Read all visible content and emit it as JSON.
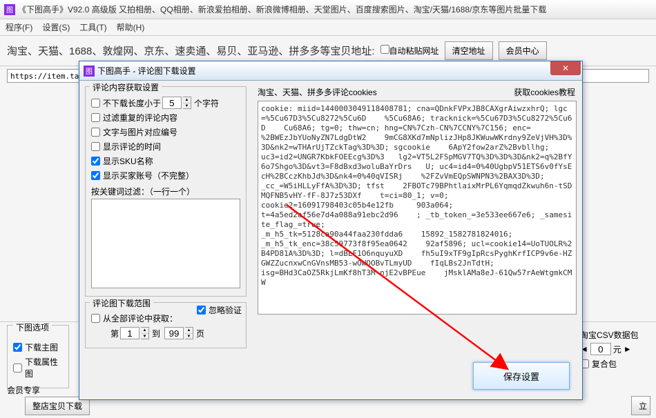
{
  "main": {
    "title": "《下图高手》V92.0 高级版 又拍相册、QQ相册、新浪爱拍相册、新浪微博相册、天堂图片、百度搜索图片、淘宝/天猫/1688/京东等图片批量下载",
    "menu": {
      "program": "程序(F)",
      "settings": "设置(S)",
      "tools": "工具(T)",
      "help": "帮助(H)"
    },
    "toolbar": {
      "label": "淘宝、天猫、1688、敦煌网、京东、速卖通、易贝、亚马逊、拼多多等宝贝地址:",
      "auto_paste": "自动粘贴网址",
      "clear_btn": "清空地址",
      "center_btn": "会员中心"
    },
    "url_value": "https://item.tao",
    "bottom": {
      "download_opts": "下图选项",
      "dl_main": "下载主图",
      "dl_attr": "下载属性图",
      "member": "会员专享",
      "whole": "整店宝贝下载",
      "csv_title": "淘宝CSV数据包",
      "price": "0",
      "unit": "元",
      "combo": "复合包",
      "go": "立"
    }
  },
  "dialog": {
    "title": "下图高手 - 评论图下载设置",
    "group1_title": "评论内容获取设置",
    "opt_minlen": "不下载长度小于",
    "opt_minlen_val": "5",
    "opt_minlen_suffix": "个字符",
    "opt_dedup": "过滤重复的评论内容",
    "opt_txtimg": "文字与图片对应编号",
    "opt_time": "显示评论的时间",
    "opt_sku": "显示SKU名称",
    "opt_buyer": "显示买家账号（不完整）",
    "kw_label": "按关键词过滤：（一行一个）",
    "group2_title": "评论图下载范围",
    "opt_ignore_v": "忽略验证",
    "opt_fromall": "从全部评论中获取：",
    "page_from_lbl": "第",
    "page_from": "1",
    "page_to_lbl": "到",
    "page_to": "99",
    "page_suffix": "页",
    "right_title": "淘宝、天猫、拼多多评论cookies",
    "tutorial": "获取cookies教程",
    "cookies": "cookie: miid=1440003049118408781; cna=QDnkFVPxJB8CAXgrAiwzxhrQ; lgc=%5Cu67D3%5Cu8272%5Cu6D    %5Cu68A6; tracknick=%5Cu67D3%5Cu8272%5Cu6D    Cu68A6; tg=0; thw=cn; hng=CN%7Czh-CN%7CCNY%7C156; enc=\n%2BWEzJbYUoNyZN7LdgDtW2    9mCG8XKd7mNplizJHp8JKWuwWKrdny9ZeVjVH%3D%3D&nk2=wTHArUjTZckTag%3D%3D; sgcookie    6ApY2fow2arZ%2Bvbllhg;\nuc3=id2=UNGR7KbkFOEEcg%3D%3   lg2=VT5L2FSpMGV7TQ%3D%3D%3D&nk2=q%2BfY6o7Shgo%3D&vt3=F8dBxd3woluBaYrDrs   U; uc4=id4=0%40UgbpV51ETS6v0fYsEcH%2BCczKhbJd%3D&nk4=0%40qVISRj    %2FZvVmEQpSWNPN3%2BAX3D%3D;\n_cc_=W5iHLLyFfA%3D%3D; tfst    2FBOTc79BPhtlaixMrPL6YqmqdZkwuh6n-tSDMQFNB5vHY-fF-8J7z53DXf    t=ci=80_1; v=0;\ncookie2=16091798403c05b4e12fb     903a064;\nt=4a5ed2af56e7d4a088a91ebc2d96    ; _tb_token_=3e533ee667e6; _samesite_flag_=true;\n_m_h5_tk=5128ca90a44faa230fdda6    15892_1582781824016;\n_m_h5_tk_enc=38c59773f8f95ea0642    92af5896; ucl=cookie14=UoTUOLR%2B4PD81A%3D%3D; l=dBLF1O6nquyuXD    fh5uI9xTF9gIpRcsPyghKrfICP9v6e-HZGWZZucnxwCnGVnsMB53-wOWOOBvTLmyUD    fIqLBs2JnTdtH;\nisg=BHd3CaOZ5RkjLmKf8hT3M-njE2vBPEue    jMsklAMa8eJ-61Qw57rAeWtgmkCMW",
    "save": "保存设置"
  }
}
